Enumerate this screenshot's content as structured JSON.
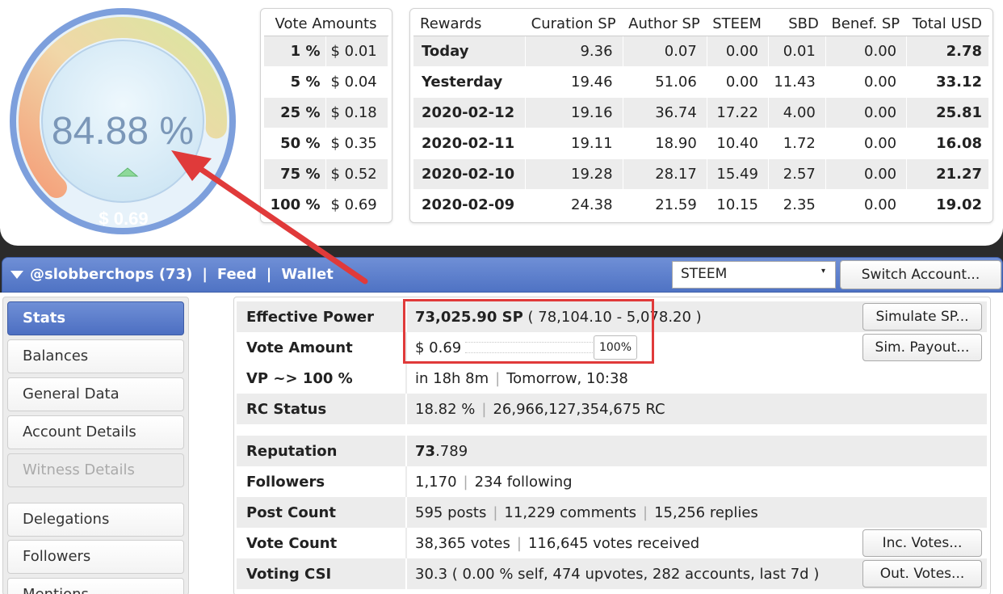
{
  "gauge": {
    "percent_text": "84.88 %",
    "amount_text": "$ 0.69",
    "percent": 84.88
  },
  "vote_amounts": {
    "header": "Vote Amounts",
    "rows": [
      {
        "pct": "1 %",
        "usd": "$ 0.01"
      },
      {
        "pct": "5 %",
        "usd": "$ 0.04"
      },
      {
        "pct": "25 %",
        "usd": "$ 0.18"
      },
      {
        "pct": "50 %",
        "usd": "$ 0.35"
      },
      {
        "pct": "75 %",
        "usd": "$ 0.52"
      },
      {
        "pct": "100 %",
        "usd": "$ 0.69"
      }
    ]
  },
  "rewards": {
    "headers": [
      "Rewards",
      "Curation SP",
      "Author SP",
      "STEEM",
      "SBD",
      "Benef. SP",
      "Total USD"
    ],
    "rows": [
      [
        "Today",
        "9.36",
        "0.07",
        "0.00",
        "0.01",
        "0.00",
        "2.78"
      ],
      [
        "Yesterday",
        "19.46",
        "51.06",
        "0.00",
        "11.43",
        "0.00",
        "33.12"
      ],
      [
        "2020-02-12",
        "19.16",
        "36.74",
        "17.22",
        "4.00",
        "0.00",
        "25.81"
      ],
      [
        "2020-02-11",
        "19.11",
        "18.90",
        "10.40",
        "1.72",
        "0.00",
        "16.08"
      ],
      [
        "2020-02-10",
        "19.28",
        "28.17",
        "15.49",
        "2.57",
        "0.00",
        "21.27"
      ],
      [
        "2020-02-09",
        "24.38",
        "21.59",
        "10.15",
        "2.35",
        "0.00",
        "19.02"
      ]
    ]
  },
  "account_bar": {
    "account": "@slobberchops (73)",
    "sep": "|",
    "feed": "Feed",
    "wallet": "Wallet",
    "chain": "STEEM",
    "caret": "▾",
    "switch": "Switch Account..."
  },
  "sidebar": {
    "items": [
      {
        "label": "Stats",
        "state": "active"
      },
      {
        "label": "Balances",
        "state": "normal"
      },
      {
        "label": "General Data",
        "state": "normal"
      },
      {
        "label": "Account Details",
        "state": "normal"
      },
      {
        "label": "Witness Details",
        "state": "disabled"
      },
      {
        "label": "Delegations",
        "state": "normal"
      },
      {
        "label": "Followers",
        "state": "normal"
      },
      {
        "label": "Mentions",
        "state": "normal"
      }
    ]
  },
  "stats": {
    "effective_power": {
      "label": "Effective Power",
      "sp": "73,025.90 SP",
      "detail": "( 78,104.10 - 5,078.20 )",
      "button": "Simulate SP..."
    },
    "vote_amount": {
      "label": "Vote Amount",
      "value": "$ 0.69",
      "pct": "100%",
      "button": "Sim. Payout..."
    },
    "vp": {
      "label": "VP ~> 100 %",
      "in": "in 18h 8m",
      "when": "Tomorrow, 10:38"
    },
    "rc": {
      "label": "RC Status",
      "pct": "18.82 %",
      "rc": "26,966,127,354,675 RC"
    },
    "reputation": {
      "label": "Reputation",
      "int": "73",
      "dec": ".789"
    },
    "followers": {
      "label": "Followers",
      "count": "1,170",
      "following": "234 following"
    },
    "post_count": {
      "label": "Post Count",
      "posts": "595 posts",
      "comments": "11,229 comments",
      "replies": "15,256 replies"
    },
    "vote_count": {
      "label": "Vote Count",
      "votes": "38,365 votes",
      "received": "116,645 votes received",
      "button": "Inc. Votes..."
    },
    "voting_csi": {
      "label": "Voting CSI",
      "value": "30.3 ( 0.00 % self, 474 upvotes, 282 accounts, last 7d )",
      "button": "Out. Votes..."
    },
    "sep": "|"
  },
  "colors": {
    "accent": "#5a7ccb",
    "annotation": "#e03a3a",
    "gauge_face": "#dbeef9",
    "gauge_text": "#7b97b8"
  }
}
